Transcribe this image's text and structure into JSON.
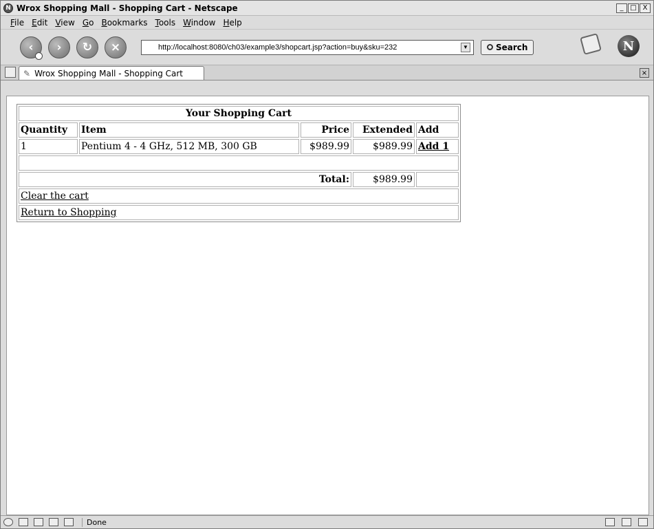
{
  "window": {
    "title": "Wrox Shopping Mall - Shopping Cart - Netscape",
    "controls": [
      "_",
      "□",
      "X"
    ]
  },
  "menu": {
    "items": [
      {
        "pre": "",
        "accel": "F",
        "post": "ile"
      },
      {
        "pre": "",
        "accel": "E",
        "post": "dit"
      },
      {
        "pre": "",
        "accel": "V",
        "post": "iew"
      },
      {
        "pre": "",
        "accel": "G",
        "post": "o"
      },
      {
        "pre": "",
        "accel": "B",
        "post": "ookmarks"
      },
      {
        "pre": "",
        "accel": "T",
        "post": "ools"
      },
      {
        "pre": "",
        "accel": "W",
        "post": "indow"
      },
      {
        "pre": "",
        "accel": "H",
        "post": "elp"
      }
    ]
  },
  "toolbar": {
    "back_icon": "back-arrow-icon",
    "forward_icon": "forward-arrow-icon",
    "reload_icon": "reload-icon",
    "stop_icon": "stop-icon",
    "url": "http://localhost:8080/ch03/example3/shopcart.jsp?action=buy&sku=232",
    "search_label": "Search"
  },
  "tab": {
    "label": "Wrox Shopping Mall - Shopping Cart"
  },
  "cart": {
    "title": "Your Shopping Cart",
    "columns": {
      "quantity": "Quantity",
      "item": "Item",
      "price": "Price",
      "extended": "Extended",
      "add": "Add"
    },
    "rows": [
      {
        "quantity": "1",
        "item": "Pentium 4 - 4 GHz, 512 MB, 300 GB",
        "price": "$989.99",
        "extended": "$989.99",
        "add_link": "Add 1"
      }
    ],
    "total_label": "Total:",
    "total_value": "$989.99",
    "clear_link": "Clear the cart",
    "return_link": "Return to Shopping"
  },
  "status": {
    "text": "Done"
  }
}
